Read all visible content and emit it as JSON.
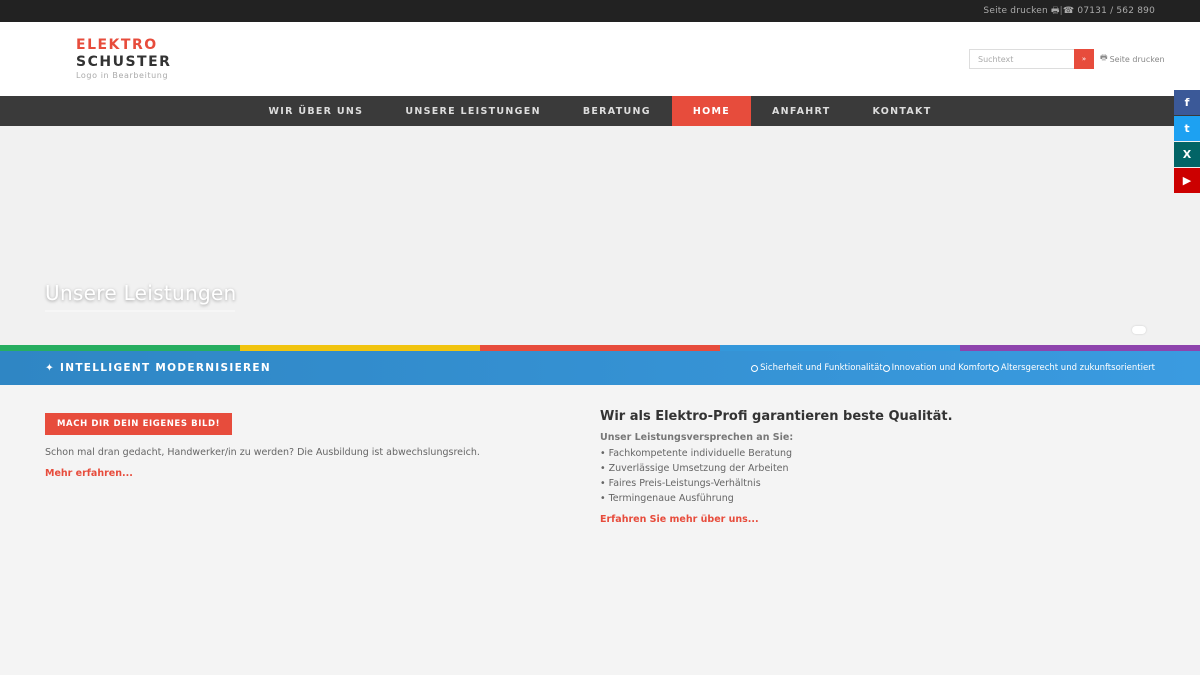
{
  "topbar": {
    "print": "Seite drucken",
    "separator": "|",
    "phone": "07131 / 562 890"
  },
  "logo": {
    "line1": "ELEKTRO",
    "line2": "SCHUSTER",
    "sub": "Logo in Bearbeitung"
  },
  "search": {
    "placeholder": "Suchtext",
    "button_label": "»",
    "print": "Seite drucken"
  },
  "nav": {
    "items": [
      {
        "label": "WIR ÜBER UNS"
      },
      {
        "label": "UNSERE LEISTUNGEN"
      },
      {
        "label": "BERATUNG"
      },
      {
        "label": "HOME",
        "active": true
      },
      {
        "label": "ANFAHRT"
      },
      {
        "label": "KONTAKT"
      }
    ]
  },
  "hero": {
    "title": "Unsere Leistungen"
  },
  "colors": {
    "accent": "#e74c3c",
    "bar": [
      "#27ae60",
      "#f1c40f",
      "#e74c3c",
      "#3498db",
      "#8e44ad"
    ]
  },
  "bluebar": {
    "title": "✦ INTELLIGENT MODERNISIEREN",
    "features": [
      "Sicherheit und Funktionalität",
      "Innovation und Komfort",
      "Altersgerecht und zukunftsorientiert"
    ]
  },
  "left": {
    "button": "MACH DIR DEIN EIGENES BILD!",
    "text": "Schon mal dran gedacht, Handwerker/in zu werden? Die Ausbildung ist abwechslungsreich.",
    "more": "Mehr erfahren..."
  },
  "right": {
    "heading": "Wir als Elektro-Profi garantieren beste Qualität.",
    "promise_title": "Unser Leistungsversprechen an Sie:",
    "items": [
      "• Fachkompetente individuelle Beratung",
      "• Zuverlässige Umsetzung der Arbeiten",
      "• Faires Preis-Leistungs-Verhältnis",
      "• Termingenaue Ausführung"
    ],
    "more": "Erfahren Sie mehr über uns..."
  },
  "social": [
    {
      "label": "f",
      "icon": "facebook-icon",
      "color": "#3b5998"
    },
    {
      "label": "t",
      "icon": "twitter-icon",
      "color": "#1da1f2"
    },
    {
      "label": "X",
      "icon": "xing-icon",
      "color": "#026466"
    },
    {
      "label": "▶",
      "icon": "youtube-icon",
      "color": "#cc0000"
    }
  ]
}
